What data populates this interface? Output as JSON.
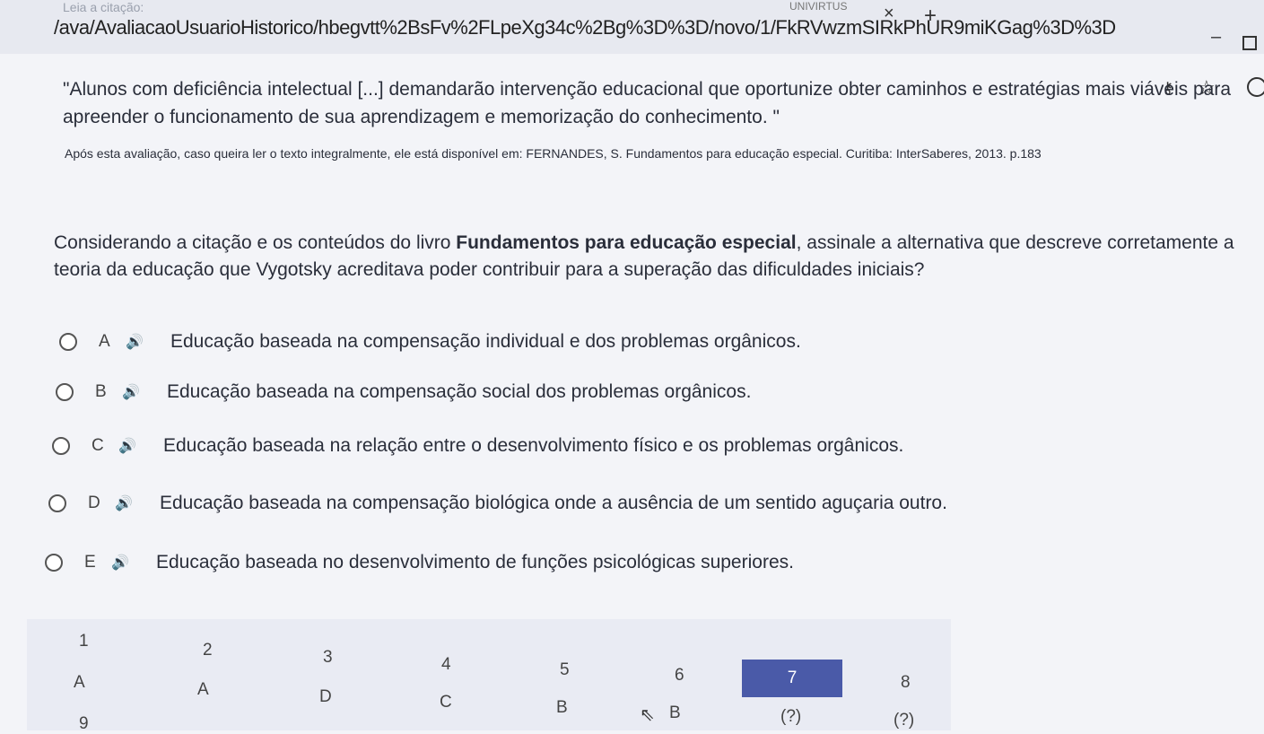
{
  "browser": {
    "url_text": "/ava/AvaliacaoUsuarioHistorico/hbegvtt%2BsFv%2FLpeXg34c%2Bg%3D%3D/novo/1/FkRVwzmSIRkPhUR9miKGag%3D%3D",
    "faded_label": "Leia a citação:",
    "tab_label": "UNIVIRTUS"
  },
  "quote": {
    "text": "\"Alunos com deficiência intelectual [...] demandarão intervenção educacional que oportunize obter caminhos e estratégias mais viáveis para apreender o funcionamento de sua aprendizagem e memorização do conhecimento. \"",
    "source": "Após esta avaliação, caso queira ler o texto integralmente, ele está disponível em: FERNANDES, S. Fundamentos para educação especial. Curitiba: InterSaberes, 2013. p.183"
  },
  "question": {
    "before": "Considerando a citação e os conteúdos do livro ",
    "bold": "Fundamentos para educação especial",
    "after": ", assinale a alternativa que descreve corretamente a teoria da educação que Vygotsky acreditava poder contribuir para a superação das dificuldades iniciais?"
  },
  "options": [
    {
      "letter": "A",
      "text": "Educação baseada na compensação individual e dos problemas orgânicos."
    },
    {
      "letter": "B",
      "text": "Educação baseada na compensação social dos problemas orgânicos."
    },
    {
      "letter": "C",
      "text": "Educação baseada na relação entre o desenvolvimento físico e os problemas orgânicos."
    },
    {
      "letter": "D",
      "text": "Educação baseada na compensação biológica onde a ausência de um sentido aguçaria outro."
    },
    {
      "letter": "E",
      "text": "Educação baseada no desenvolvimento de funções psicológicas superiores."
    }
  ],
  "navigator": {
    "numbers": [
      "1",
      "2",
      "3",
      "4",
      "5",
      "6",
      "7",
      "8"
    ],
    "answers": [
      "A",
      "A",
      "D",
      "C",
      "B",
      "B",
      "(?)",
      "(?)"
    ],
    "next_row_partial": "9",
    "active_index": 6,
    "active_color": "#4a5aa8"
  },
  "icons": {
    "speaker": "speaker-icon",
    "close": "close-icon",
    "new_tab": "plus-icon",
    "key": "key-icon",
    "star": "star-icon",
    "profile": "profile-icon",
    "cursor": "cursor-icon"
  }
}
